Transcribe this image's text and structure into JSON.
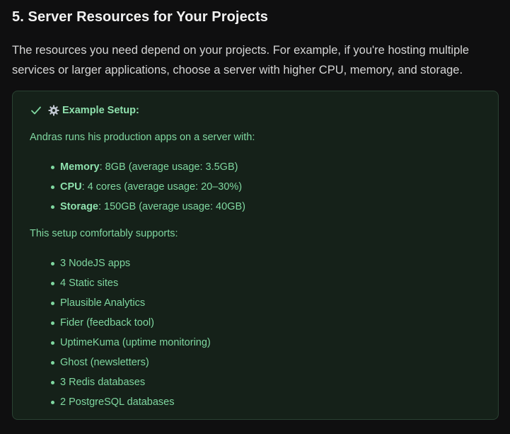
{
  "heading": "5. Server Resources for Your Projects",
  "intro": "The resources you need depend on your projects. For example, if you're hosting multiple services or larger applications, choose a server with higher CPU, memory, and storage.",
  "callout": {
    "icon": "check-icon",
    "emoji_icon": "gear-icon",
    "title": "Example Setup:",
    "lead": "Andras runs his production apps on a server with:",
    "specs": [
      {
        "label": "Memory",
        "value": ": 8GB (average usage: 3.5GB)"
      },
      {
        "label": "CPU",
        "value": ": 4 cores (average usage: 20–30%)"
      },
      {
        "label": "Storage",
        "value": ": 150GB (average usage: 40GB)"
      }
    ],
    "supports_lead": "This setup comfortably supports:",
    "supports": [
      "3 NodeJS apps",
      "4 Static sites",
      "Plausible Analytics",
      "Fider (feedback tool)",
      "UptimeKuma (uptime monitoring)",
      "Ghost (newsletters)",
      "3 Redis databases",
      "2 PostgreSQL databases"
    ]
  },
  "colors": {
    "page_bg": "#0f0f10",
    "callout_bg": "#152119",
    "callout_border": "#2a4233",
    "accent_green": "#7fd7a0"
  }
}
